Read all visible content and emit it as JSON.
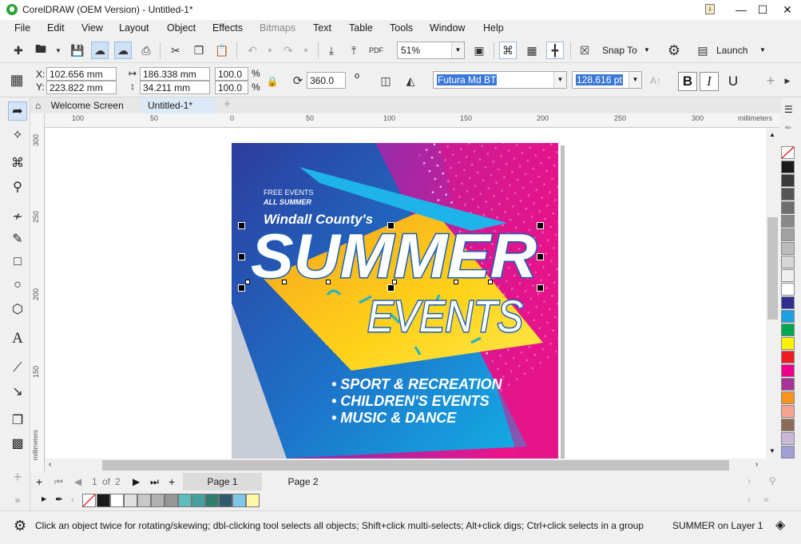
{
  "window": {
    "title": "CorelDRAW (OEM Version) - Untitled-1*"
  },
  "menu": [
    "File",
    "Edit",
    "View",
    "Layout",
    "Object",
    "Effects",
    "Bitmaps",
    "Text",
    "Table",
    "Tools",
    "Window",
    "Help"
  ],
  "toolbar": {
    "zoom": "51%",
    "snap_label": "Snap To",
    "launch_label": "Launch",
    "pdf_label": "PDF"
  },
  "property_bar": {
    "x_label": "X:",
    "y_label": "Y:",
    "x_value": "102.656 mm",
    "y_value": "223.822 mm",
    "width_value": "186.338 mm",
    "height_value": "34.211 mm",
    "scale_x": "100.0",
    "scale_y": "100.0",
    "percent": "%",
    "rotation": "360.0",
    "rotation_unit": "o",
    "font": "Futura Md BT",
    "font_size": "128.616 pt",
    "bold": "B",
    "italic": "I",
    "underline": "U"
  },
  "tabs": {
    "home": "Welcome Screen",
    "doc": "Untitled-1*"
  },
  "ruler": {
    "unit": "millimeters",
    "h_labels": [
      "100",
      "50",
      "0",
      "50",
      "100",
      "150",
      "200",
      "250",
      "300"
    ],
    "v_labels": [
      "300",
      "250",
      "200",
      "150"
    ]
  },
  "artwork": {
    "free_events": "FREE EVENTS",
    "all_summer": "ALL SUMMER",
    "county": "Windall County's",
    "summer": "SUMMER",
    "events": "EVENTS",
    "bullets": [
      "• SPORT & RECREATION",
      "• CHILDREN'S EVENTS",
      "• MUSIC & DANCE"
    ]
  },
  "pages": {
    "current": "1",
    "of_label": "of",
    "total": "2",
    "tabs": [
      "Page 1",
      "Page 2"
    ]
  },
  "palette_colors": [
    "#1a1a1a",
    "#3a3a3a",
    "#555555",
    "#6e6e6e",
    "#888888",
    "#a1a1a1",
    "#bcbcbc",
    "#d6d6d6",
    "#efefef",
    "#ffffff",
    "#2f2f8f",
    "#1ba1e2",
    "#00a651",
    "#fff200",
    "#ed1c24",
    "#ec008c",
    "#a83296",
    "#f7941d",
    "#f6a38f",
    "#8b6b5a",
    "#c9b8d9",
    "#9f9fd6"
  ],
  "colorbar_colors": [
    "#1a1a1a",
    "#ffffff",
    "#e0e0e0",
    "#c8c8c8",
    "#b0b0b0",
    "#969696",
    "#5fbcbc",
    "#47a0a0",
    "#2f7d6e",
    "#305a6e",
    "#7fc6e8",
    "#fff8a8"
  ],
  "status": {
    "hint": "Click an object twice for rotating/skewing; dbl-clicking tool selects all objects; Shift+click multi-selects; Alt+click digs; Ctrl+click selects in a group",
    "layer": "SUMMER on Layer 1"
  }
}
